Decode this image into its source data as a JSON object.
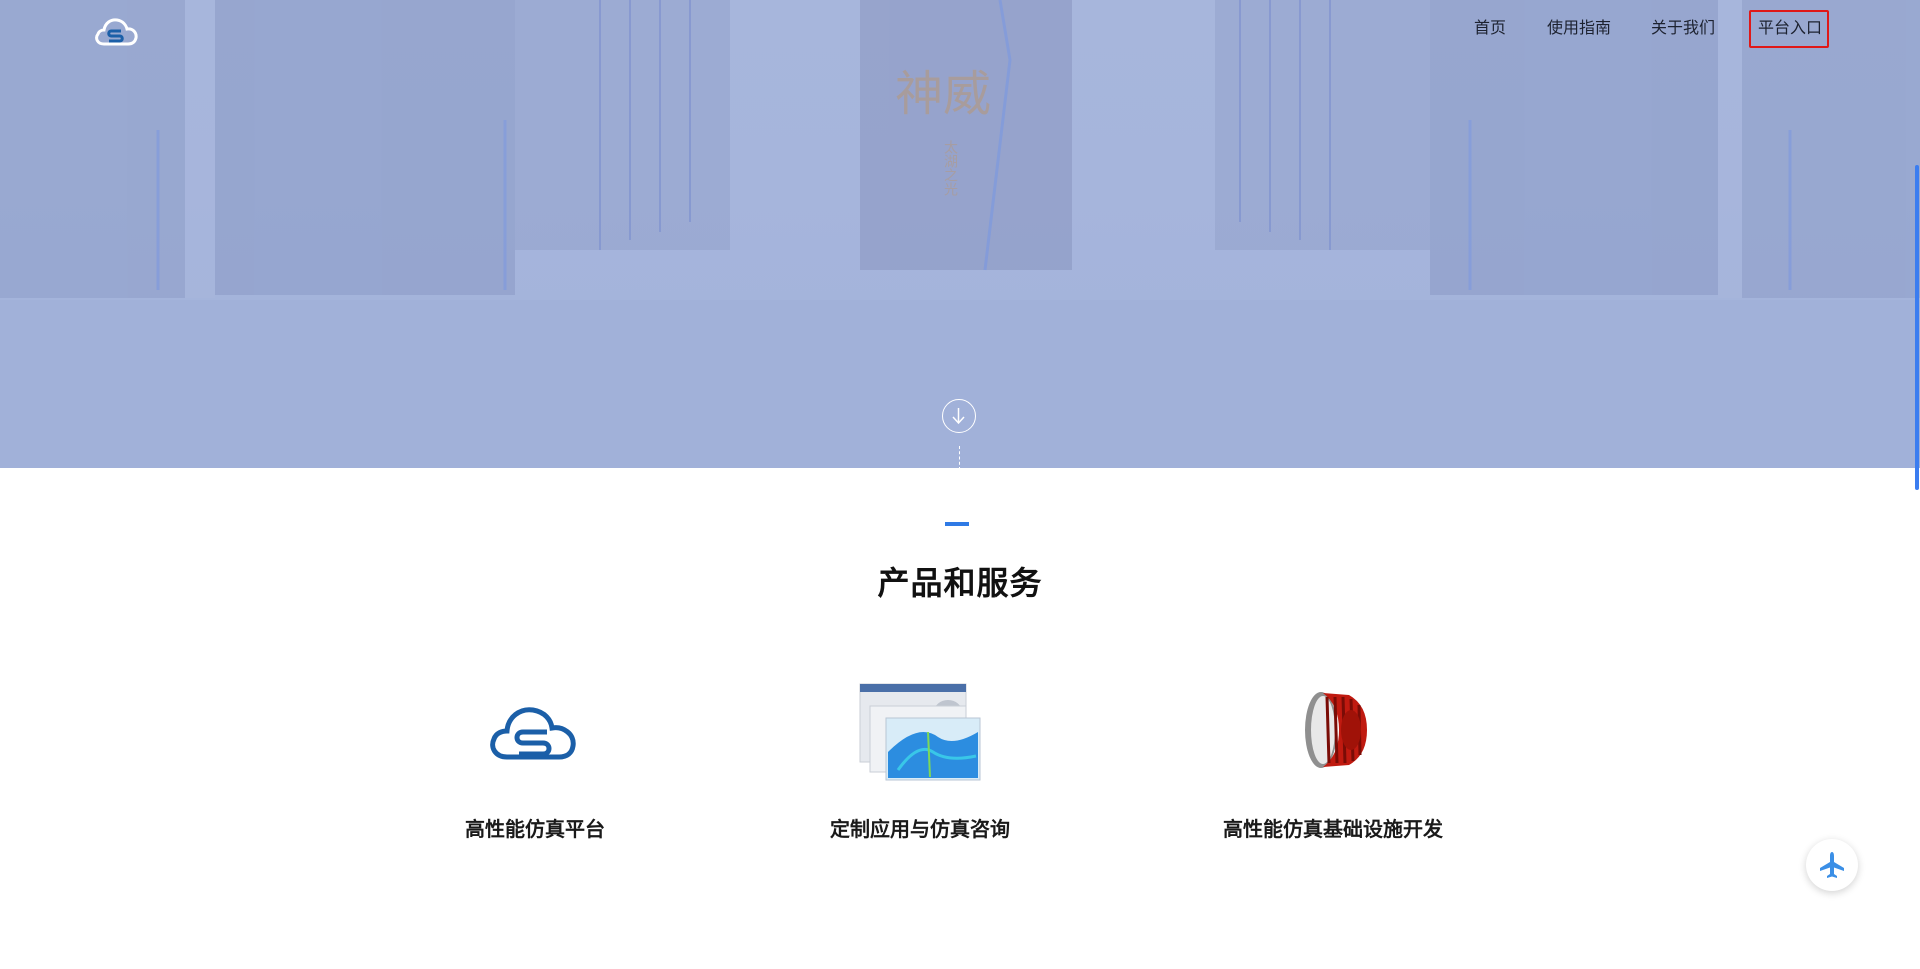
{
  "nav": {
    "home": "首页",
    "guide": "使用指南",
    "about": "关于我们",
    "entry": "平台入口"
  },
  "hero": {
    "rack_text_large": "神威",
    "rack_text_small": "太湖之光"
  },
  "section": {
    "title": "产品和服务"
  },
  "cards": [
    {
      "label": "高性能仿真平台",
      "icon": "cloud-s-icon"
    },
    {
      "label": "定制应用与仿真咨询",
      "icon": "simulation-screens-image"
    },
    {
      "label": "高性能仿真基础设施开发",
      "icon": "red-gear-model-image"
    }
  ],
  "colors": {
    "accent": "#2f7ae5",
    "hero_tint": "#a6b5dc",
    "entry_border": "#e01818",
    "logo_blue": "#1b5fa8"
  }
}
